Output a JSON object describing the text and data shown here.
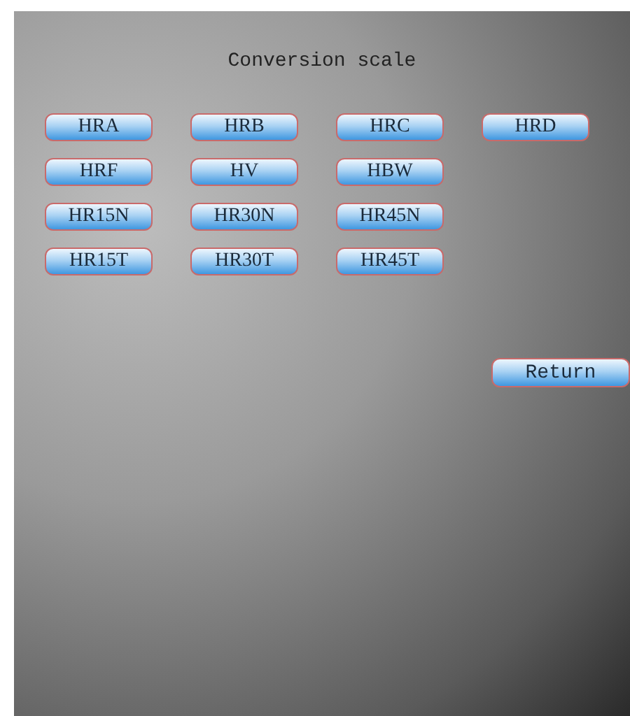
{
  "title": "Conversion scale",
  "scales": [
    [
      "HRA",
      "HRB",
      "HRC",
      "HRD"
    ],
    [
      "HRF",
      "HV",
      "HBW"
    ],
    [
      "HR15N",
      "HR30N",
      "HR45N"
    ],
    [
      "HR15T",
      "HR30T",
      "HR45T"
    ]
  ],
  "return_button": "Return"
}
